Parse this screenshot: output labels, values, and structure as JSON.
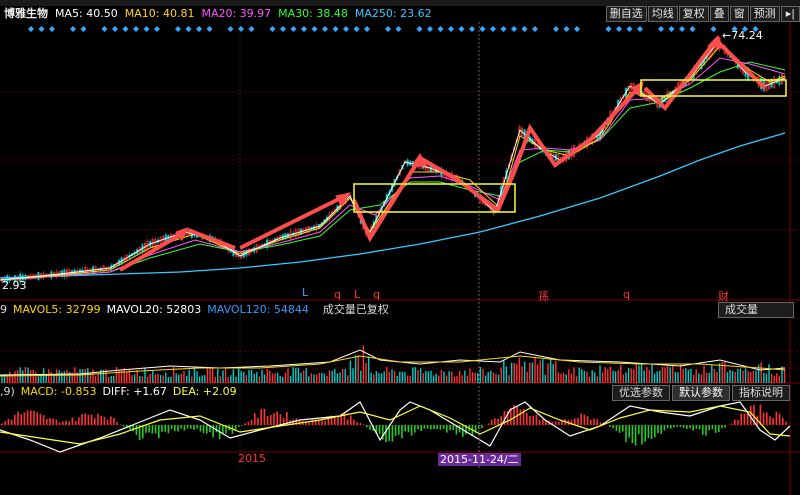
{
  "header": {
    "stock_name": "博雅生物",
    "ma": [
      {
        "label": "MA5:",
        "value": "40.50",
        "color": "#ffffff"
      },
      {
        "label": "MA10:",
        "value": "40.81",
        "color": "#ffd700"
      },
      {
        "label": "MA20:",
        "value": "39.97",
        "color": "#ff55ff"
      },
      {
        "label": "MA30:",
        "value": "38.48",
        "color": "#33ff33"
      },
      {
        "label": "MA250:",
        "value": "23.62",
        "color": "#33ccff"
      }
    ]
  },
  "toolbar": {
    "buttons": [
      "删自选",
      "均线",
      "复权",
      "叠",
      "窗",
      "预测"
    ],
    "nav_icon": "end-arrow-icon"
  },
  "price_chart": {
    "high_label": "74.24",
    "low_label": "2.93",
    "event_markers": [
      "L",
      "q",
      "L",
      "q",
      "孫",
      "q",
      "财"
    ]
  },
  "volume_panel": {
    "prefix": "9",
    "mavol5_label": "MAVOL5:",
    "mavol5_value": "32799",
    "mavol20_label": "MAVOL20:",
    "mavol20_value": "52803",
    "mavol120_label": "MAVOL120:",
    "mavol120_value": "54844",
    "note": "成交量已复权",
    "dropdown": "成交量"
  },
  "macd_panel": {
    "prefix": ",9)",
    "macd_label": "MACD:",
    "macd_value": "-0.853",
    "diff_label": "DIFF:",
    "diff_value": "+1.67",
    "dea_label": "DEA:",
    "dea_value": "+2.09",
    "buttons": [
      "优选参数",
      "默认参数",
      "指标说明"
    ]
  },
  "time_axis": {
    "year_label": "2015",
    "cursor_date": "2015-11-24/二"
  },
  "colors": {
    "background": "#000000",
    "up": "#ff3333",
    "down": "#00cccc",
    "annotation_arrow": "#ff4d4d",
    "annotation_box": "#ffff33",
    "ma250": "#33ccff",
    "signal_diamond": "#33aaff"
  }
}
